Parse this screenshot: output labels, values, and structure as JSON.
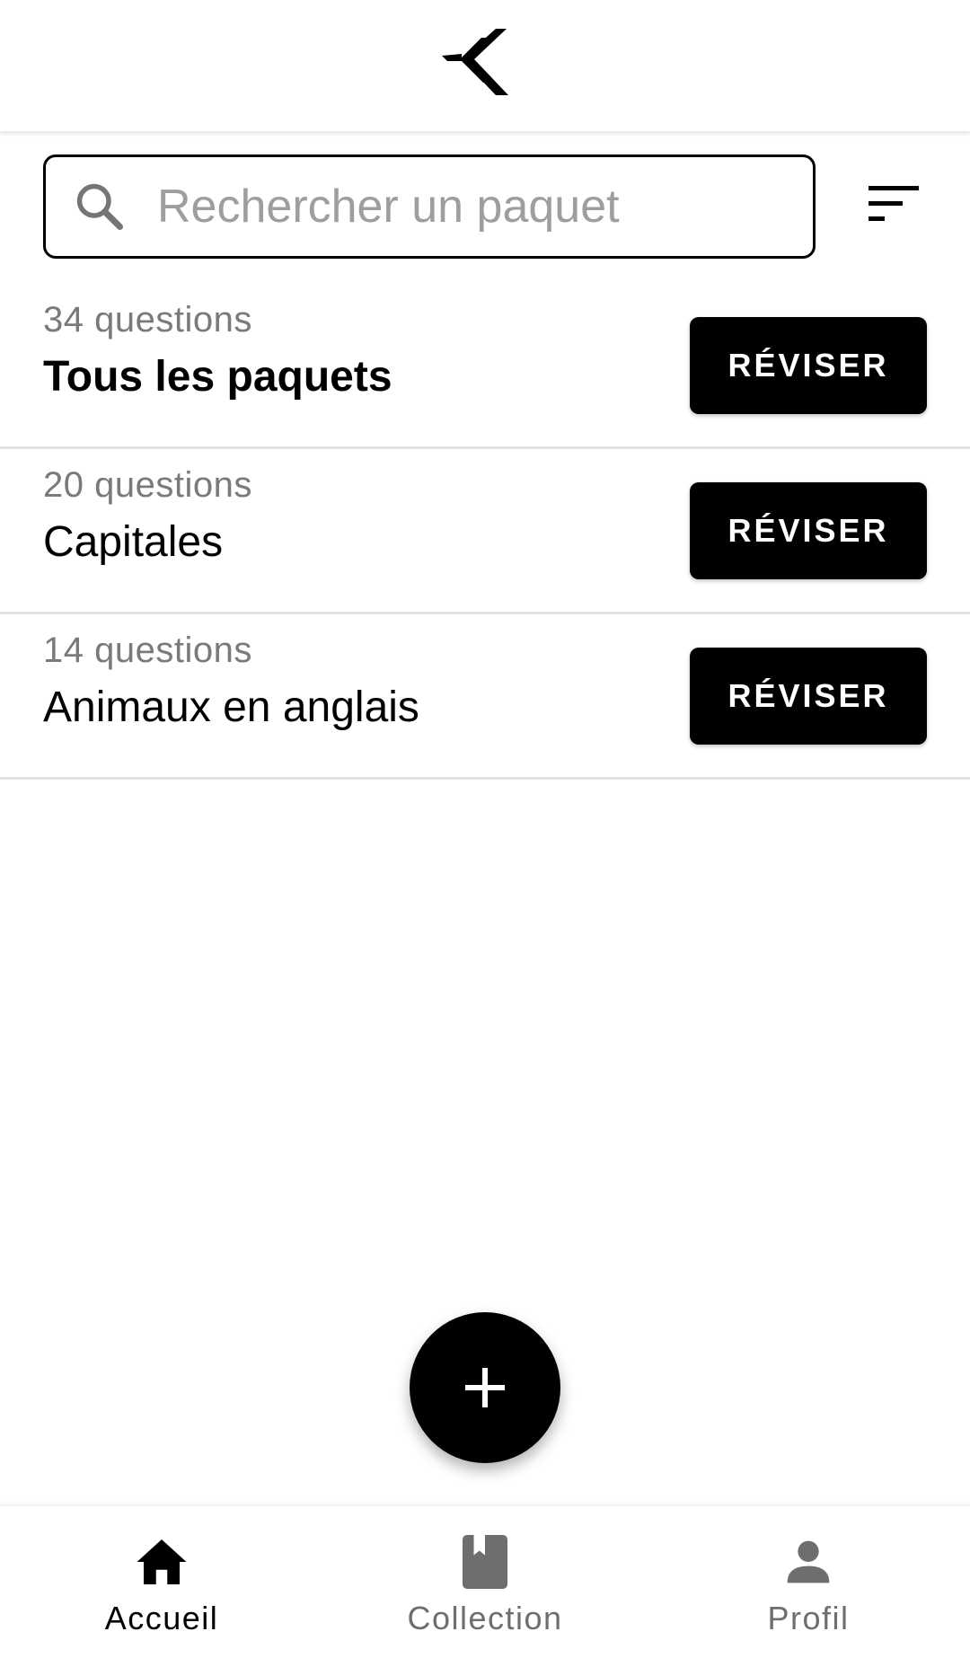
{
  "header": {
    "logo_icon": "chevron-double-left-logo"
  },
  "search": {
    "placeholder": "Rechercher un paquet",
    "value": "",
    "icon": "search-icon"
  },
  "filter": {
    "icon": "sort-icon"
  },
  "decks": [
    {
      "count": "34 questions",
      "name": "Tous les paquets",
      "button": "RÉVISER"
    },
    {
      "count": "20 questions",
      "name": "Capitales",
      "button": "RÉVISER"
    },
    {
      "count": "14 questions",
      "name": "Animaux en anglais",
      "button": "RÉVISER"
    }
  ],
  "fab": {
    "icon": "plus-icon"
  },
  "nav": {
    "items": [
      {
        "label": "Accueil",
        "icon": "home-icon",
        "active": true
      },
      {
        "label": "Collection",
        "icon": "book-icon",
        "active": false
      },
      {
        "label": "Profil",
        "icon": "person-icon",
        "active": false
      }
    ]
  },
  "colors": {
    "primary": "#000000",
    "background": "#ffffff",
    "muted_text": "#7a7a7a",
    "inactive_nav": "#6e6e6e",
    "divider": "#e2e2e2"
  }
}
